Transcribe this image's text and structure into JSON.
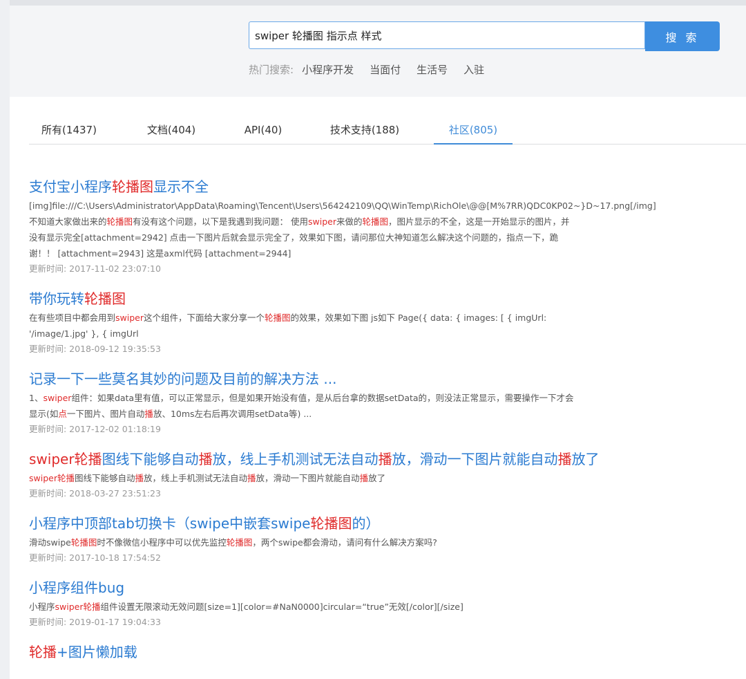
{
  "search": {
    "query": "swiper 轮播图 指示点 样式",
    "button_label": "搜 索",
    "hot_label": "热门搜索:",
    "hot_links": [
      "小程序开发",
      "当面付",
      "生活号",
      "入驻"
    ]
  },
  "tabs": [
    {
      "label": "所有(1437)"
    },
    {
      "label": "文档(404)"
    },
    {
      "label": "API(40)"
    },
    {
      "label": "技术支持(188)"
    },
    {
      "label": "社区(805)"
    }
  ],
  "colors": {
    "accent": "#3e8ee0",
    "link": "#2b7bd1",
    "highlight": "#e02b2b",
    "muted": "#999999"
  },
  "results": [
    {
      "title": [
        {
          "text": "支付宝小程序"
        },
        {
          "text": "轮播图",
          "hl": true
        },
        {
          "text": "显示不全"
        }
      ],
      "desc": [
        {
          "text": "[img]file:///C:\\Users\\Administrator\\AppData\\Roaming\\Tencent\\Users\\564242109\\QQ\\WinTemp\\RichOle\\@@[M%7RR)QDC0KP02~}D~17.png[/img]"
        },
        {
          "br": true
        },
        {
          "text": "不知道大家做出来的"
        },
        {
          "text": "轮播图",
          "hl": true
        },
        {
          "text": "有没有这个问题，以下是我遇到我问题： 使用"
        },
        {
          "text": "swiper",
          "hl": true
        },
        {
          "text": "来做的"
        },
        {
          "text": "轮播图",
          "hl": true
        },
        {
          "text": "，图片显示的不全，这是一开始显示的图片，并"
        },
        {
          "br": true
        },
        {
          "text": "没有显示完全[attachment=2942] 点击一下图片后就会显示完全了，效果如下图，请问那位大神知道怎么解决这个问题的，指点一下，跪"
        },
        {
          "br": true
        },
        {
          "text": "谢！！ [attachment=2943] 这是axml代码 [attachment=2944]"
        }
      ],
      "time": "更新时间: 2017-11-02 23:07:10"
    },
    {
      "title": [
        {
          "text": "带你玩转"
        },
        {
          "text": "轮播图",
          "hl": true
        }
      ],
      "desc": [
        {
          "text": "在有些项目中都会用到"
        },
        {
          "text": "swiper",
          "hl": true
        },
        {
          "text": "这个组件，下面给大家分享一个"
        },
        {
          "text": "轮播图",
          "hl": true
        },
        {
          "text": "的效果，效果如下图 js如下 Page({ data: { images: [ { imgUrl:"
        },
        {
          "br": true
        },
        {
          "text": "'/image/1.jpg' }, { imgUrl"
        }
      ],
      "time": "更新时间: 2018-09-12 19:35:53"
    },
    {
      "title": [
        {
          "text": "记录一下一些莫名其妙的问题及目前的解决方法 ..."
        }
      ],
      "desc": [
        {
          "text": "1、"
        },
        {
          "text": "swiper",
          "hl": true
        },
        {
          "text": "组件：如果data里有值，可以正常显示，但是如果开始没有值，是从后台拿的数据setData的，则没法正常显示，需要操作一下才会"
        },
        {
          "br": true
        },
        {
          "text": "显示(如"
        },
        {
          "text": "点",
          "hl": true
        },
        {
          "text": "一下图片、图片自动"
        },
        {
          "text": "播",
          "hl": true
        },
        {
          "text": "放、10ms左右后再次调用setData等) ..."
        }
      ],
      "time": "更新时间: 2017-12-02 01:18:19"
    },
    {
      "title": [
        {
          "text": "swiper轮播",
          "hl": true
        },
        {
          "text": "图线下能够自动"
        },
        {
          "text": "播",
          "hl": true
        },
        {
          "text": "放，线上手机测试无法自动"
        },
        {
          "text": "播",
          "hl": true
        },
        {
          "text": "放，滑动一下图片就能自动"
        },
        {
          "text": "播",
          "hl": true
        },
        {
          "text": "放了"
        }
      ],
      "desc": [
        {
          "text": "swiper轮播",
          "hl": true
        },
        {
          "text": "图线下能够自动"
        },
        {
          "text": "播",
          "hl": true
        },
        {
          "text": "放，线上手机测试无法自动"
        },
        {
          "text": "播",
          "hl": true
        },
        {
          "text": "放，滑动一下图片就能自动"
        },
        {
          "text": "播",
          "hl": true
        },
        {
          "text": "放了"
        }
      ],
      "time": "更新时间: 2018-03-27 23:51:23"
    },
    {
      "title": [
        {
          "text": "小程序中顶部tab切换卡（swipe中嵌套swipe"
        },
        {
          "text": "轮播图",
          "hl": true
        },
        {
          "text": "的）"
        }
      ],
      "desc": [
        {
          "text": "滑动swipe"
        },
        {
          "text": "轮播图",
          "hl": true
        },
        {
          "text": "时不像微信小程序中可以优先监控"
        },
        {
          "text": "轮播图",
          "hl": true
        },
        {
          "text": "，两个swipe都会滑动，请问有什么解决方案吗?"
        }
      ],
      "time": "更新时间: 2017-10-18 17:54:52"
    },
    {
      "title": [
        {
          "text": "小程序组件bug"
        }
      ],
      "desc": [
        {
          "text": "小程序"
        },
        {
          "text": "swiper轮播",
          "hl": true
        },
        {
          "text": "组件设置无限滚动无效问题[size=1][color=#NaN0000]circular=“true”无效[/color][/size]"
        }
      ],
      "time": "更新时间: 2019-01-17 19:04:33"
    },
    {
      "title": [
        {
          "text": "轮播",
          "hl": true
        },
        {
          "text": "+图片懒加载"
        }
      ],
      "desc": [],
      "time": ""
    }
  ]
}
